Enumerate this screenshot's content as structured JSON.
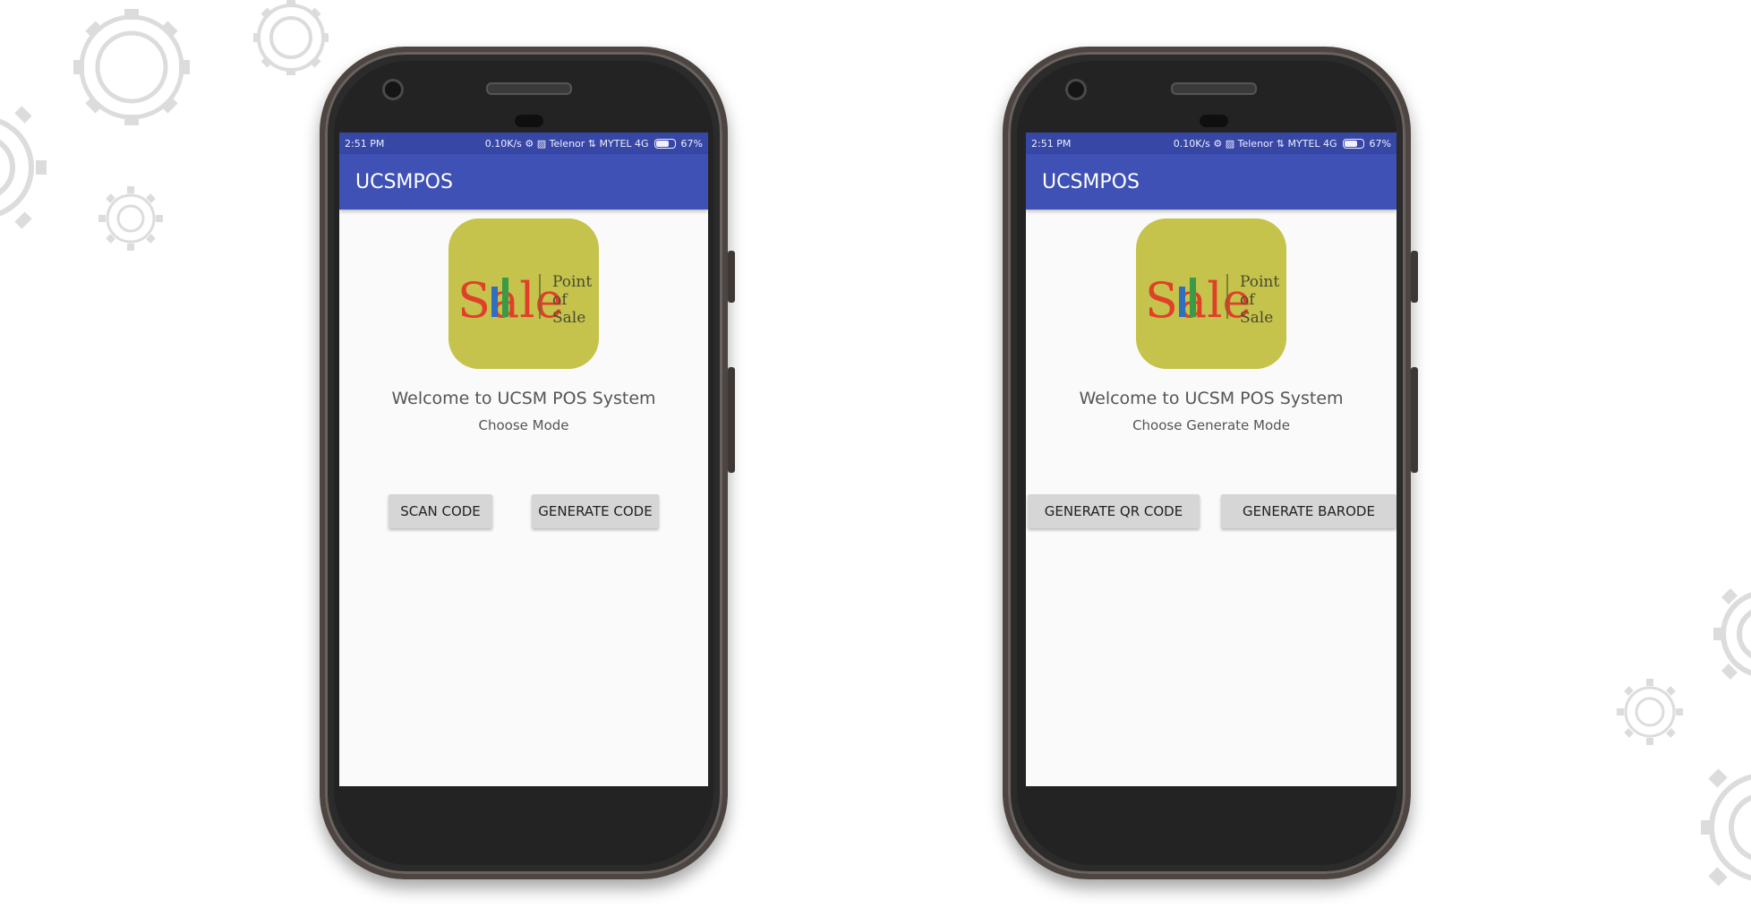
{
  "status_bar": {
    "time": "2:51 PM",
    "right_text": "0.10K/s  ⚙  ▨  Telenor  ⇅  MYTEL 4G",
    "battery": "67%",
    "battery_level": 0.67
  },
  "app": {
    "title": "UCSMPOS",
    "logo": {
      "main_text": "Sale",
      "side_lines": [
        "Point",
        "of",
        "Sale"
      ]
    },
    "welcome": "Welcome to UCSM POS System"
  },
  "screens": {
    "left": {
      "subtitle": "Choose Mode",
      "buttons": [
        "SCAN CODE",
        "GENERATE CODE"
      ]
    },
    "right": {
      "subtitle": "Choose Generate Mode",
      "buttons": [
        "GENERATE QR CODE",
        "GENERATE BARODE"
      ]
    }
  },
  "colors": {
    "app_bar": "#3f51b5",
    "status_bar": "#3747a6",
    "logo_bg": "#c5c34b",
    "button_bg": "#d6d6d6"
  }
}
